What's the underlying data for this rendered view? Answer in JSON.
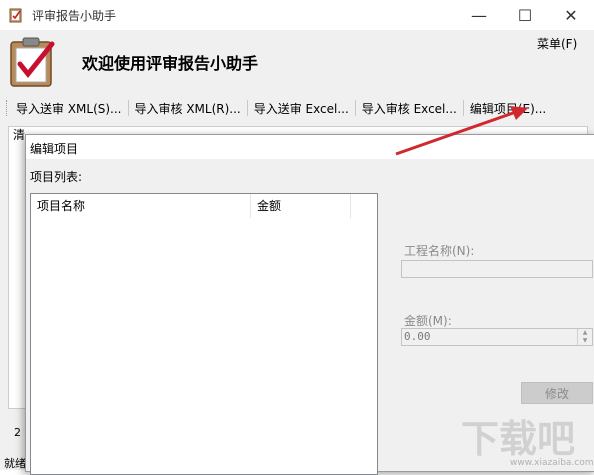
{
  "window": {
    "title": "评审报告小助手",
    "welcome": "欢迎使用评审报告小助手",
    "menu": "菜单(F)",
    "minimize_glyph": "—",
    "maximize_glyph": "☐",
    "close_glyph": "✕"
  },
  "toolbar": {
    "items": [
      "导入送审 XML(S)...",
      "导入审核 XML(R)...",
      "导入送审 Excel...",
      "导入审核 Excel...",
      "编辑项目(E)..."
    ]
  },
  "main": {
    "first_col_fragment": "清",
    "left_count": "2",
    "status": "就绪"
  },
  "dialog": {
    "title": "编辑项目",
    "list_label": "项目列表:",
    "columns": [
      "项目名称",
      "金额"
    ],
    "project_name_label": "工程名称(N):",
    "project_name_value": "",
    "amount_label": "金额(M):",
    "amount_value": "0.00",
    "modify_button": "修改"
  },
  "watermark": {
    "text": "下载吧",
    "url": "www.xiazaiba.com"
  },
  "colors": {
    "accent_arrow": "#d0282c",
    "panel_bg": "#f0f0f0",
    "disabled_text": "#8a8a8a"
  }
}
